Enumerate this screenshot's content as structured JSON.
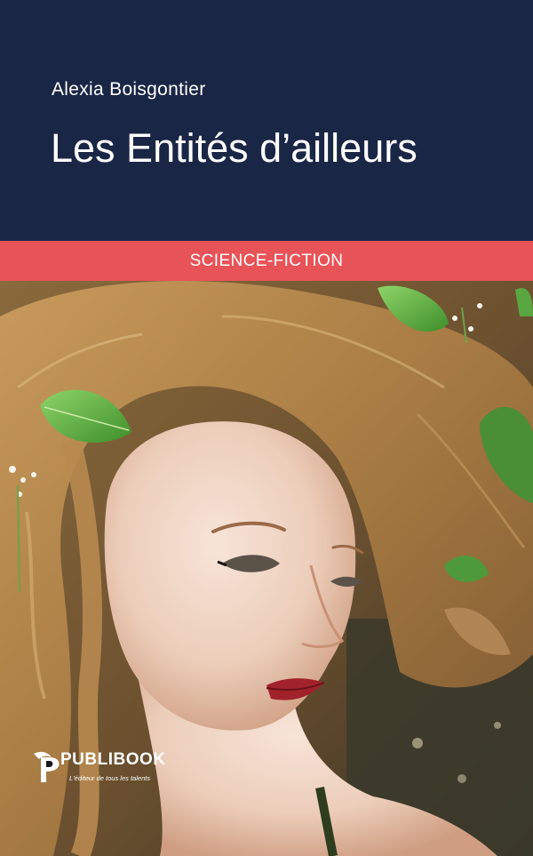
{
  "book": {
    "author": "Alexia Boisgontier",
    "title": "Les Entités d’ailleurs",
    "genre": "SCIENCE-FICTION"
  },
  "publisher": {
    "name": "PUBLIBOOK",
    "tagline": "L'éditeur de tous les talents"
  },
  "colors": {
    "header_bg": "#1a2645",
    "genre_band": "#e85357",
    "text": "#ffffff"
  },
  "cover_image": {
    "subject": "woman-portrait-with-leaves"
  }
}
